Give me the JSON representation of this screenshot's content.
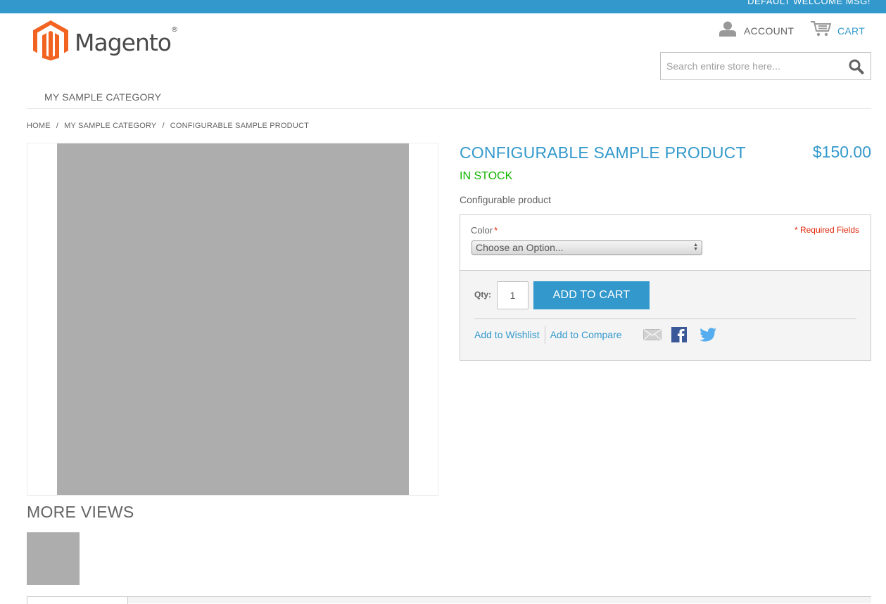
{
  "header": {
    "welcome_msg": "Default welcome msg!",
    "logo_text": "Magento",
    "logo_reg": "®",
    "account_label": "ACCOUNT",
    "cart_label": "CART",
    "search_placeholder": "Search entire store here...",
    "search_value": ""
  },
  "nav": {
    "items": [
      {
        "label": "MY SAMPLE CATEGORY"
      }
    ]
  },
  "breadcrumb": {
    "items": [
      {
        "label": "HOME"
      },
      {
        "label": "MY SAMPLE CATEGORY"
      },
      {
        "label": "CONFIGURABLE SAMPLE PRODUCT"
      }
    ],
    "separator": "/"
  },
  "product": {
    "name": "CONFIGURABLE SAMPLE PRODUCT",
    "price": "$150.00",
    "stock": "IN STOCK",
    "short_description": "Configurable product",
    "options": {
      "color_label": "Color",
      "required_marker": "*",
      "required_fields_text": "* Required Fields",
      "color_selected": "Choose an Option..."
    },
    "qty_label": "Qty:",
    "qty_value": "1",
    "add_to_cart_label": "ADD TO CART",
    "add_to_wishlist_label": "Add to Wishlist",
    "add_to_compare_label": "Add to Compare"
  },
  "gallery": {
    "more_views_title": "MORE VIEWS"
  },
  "colors": {
    "accent": "#3399cc",
    "in_stock": "#11b400",
    "required": "#df280a",
    "logo_orange": "#f26322",
    "facebook": "#3b5998",
    "twitter": "#55acee"
  }
}
